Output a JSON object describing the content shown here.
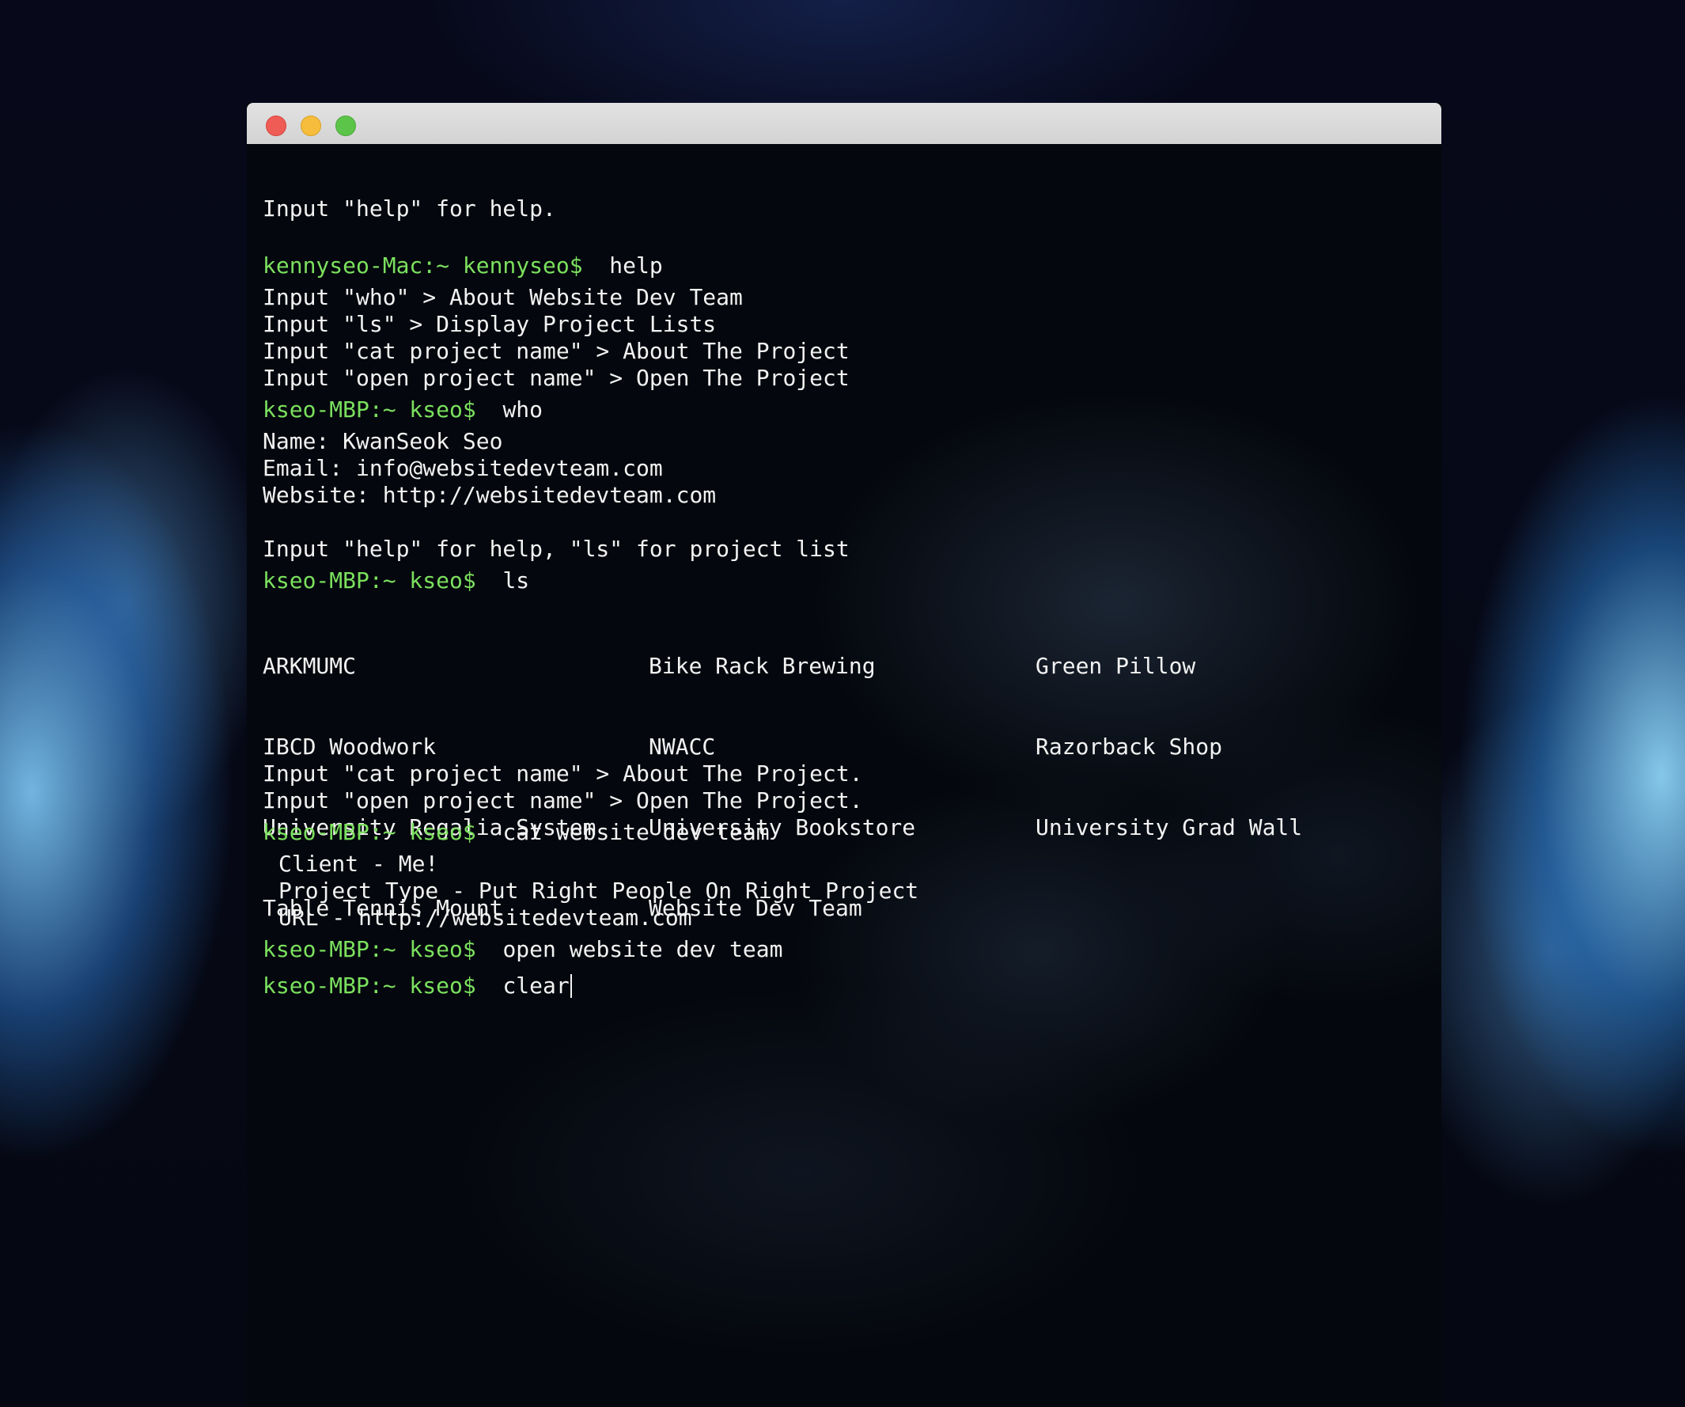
{
  "window": {
    "controls": [
      "close",
      "minimize",
      "maximize"
    ]
  },
  "terminal": {
    "intro": "Input \"help\" for help.",
    "session1": {
      "prompt": "kennyseo-Mac:~ kennyseo$",
      "command": "help",
      "output": [
        "Input \"who\" > About Website Dev Team",
        "Input \"ls\" > Display Project Lists",
        "Input \"cat project name\" > About The Project",
        "Input \"open project name\" > Open The Project"
      ]
    },
    "prompt": "kseo-MBP:~ kseo$",
    "who": {
      "command": "who",
      "output": [
        "Name: KwanSeok Seo",
        "Email: info@websitedevteam.com",
        "Website: http://websitedevteam.com"
      ],
      "hint": "Input \"help\" for help, \"ls\" for project list"
    },
    "ls": {
      "command": "ls",
      "columns": [
        [
          "ARKMUMC",
          "IBCD Woodwork",
          "University Regalia System",
          "Table Tennis Mount"
        ],
        [
          "Bike Rack Brewing",
          "NWACC",
          "University Bookstore",
          "Website Dev Team"
        ],
        [
          "Green Pillow",
          "Razorback Shop",
          "University Grad Wall"
        ]
      ],
      "hint": [
        "Input \"cat project name\" > About The Project.",
        "Input \"open project name\" > Open The Project."
      ]
    },
    "cat": {
      "command": "cat website dev team",
      "output": [
        "Client - Me!",
        "Project Type - Put Right People On Right Project",
        "URL - http://websitedevteam.com"
      ]
    },
    "open": {
      "command": "open website dev team"
    },
    "current": {
      "command": "clear"
    }
  }
}
